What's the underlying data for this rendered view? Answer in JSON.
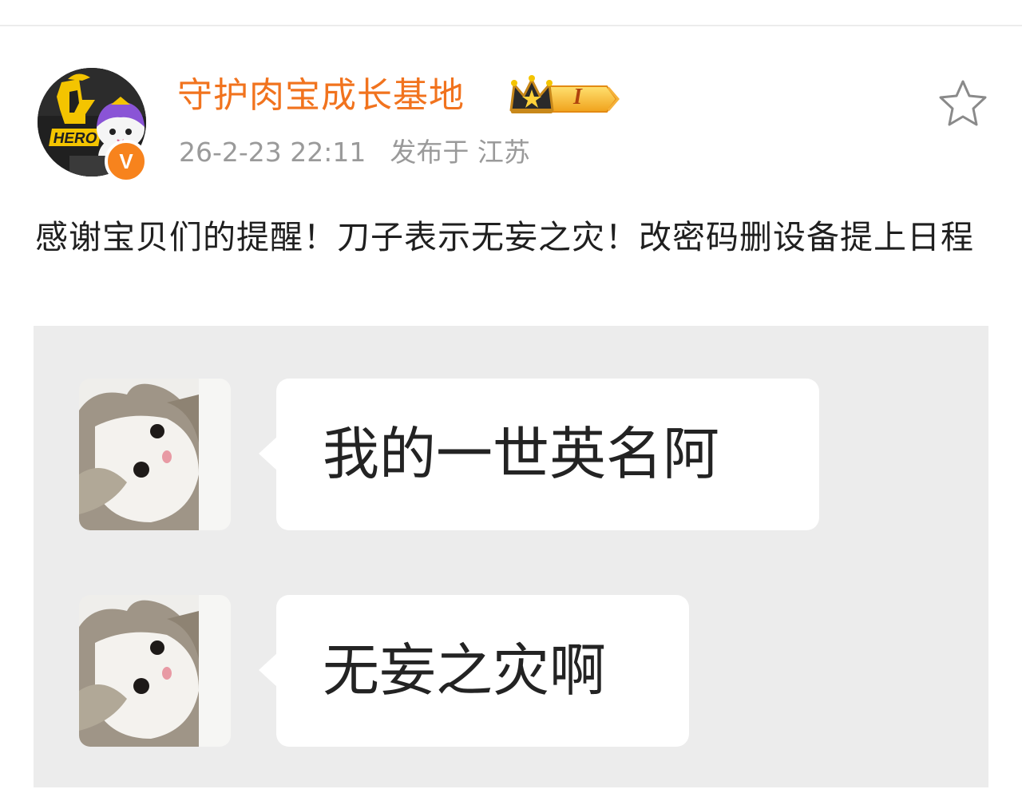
{
  "post": {
    "author": {
      "name": "守护肉宝成长基地",
      "avatar_icon": "hero-team-avatar-icon",
      "verified_badge": "V",
      "member_level": "I",
      "name_color": "#f1731e",
      "badge_color": "#f7831d"
    },
    "time": "26-2-23 22:11",
    "location": "发布于 江苏",
    "text": "感谢宝贝们的提醒！刀子表示无妄之灾！改密码删设备提上日程",
    "favorite_icon": "star-outline-icon",
    "image": {
      "background": "#ececec",
      "messages": [
        {
          "text": "我的一世英名阿",
          "avatar_icon": "cat-avatar-icon"
        },
        {
          "text": "无妄之灾啊",
          "avatar_icon": "cat-avatar-icon"
        }
      ]
    }
  }
}
